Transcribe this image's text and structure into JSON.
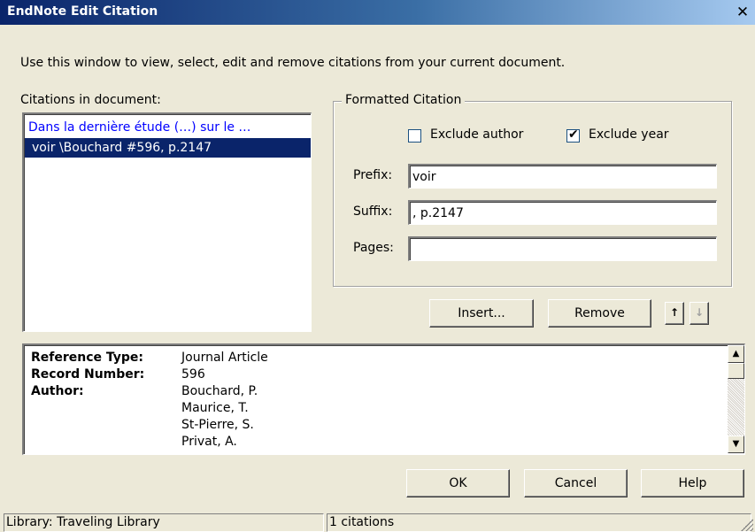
{
  "window": {
    "title": "EndNote Edit Citation",
    "close_glyph": "✕"
  },
  "instruction": "Use this window to view, select, edit and remove citations from your current document.",
  "citations": {
    "label": "Citations in document:",
    "items": [
      {
        "text": "Dans la dernière étude (…) sur le …",
        "selected": false
      },
      {
        "text": "voir \\Bouchard #596, p.2147",
        "selected": true
      }
    ]
  },
  "formatted_citation": {
    "legend": "Formatted Citation",
    "exclude_author": {
      "label": "Exclude author",
      "checked": false
    },
    "exclude_year": {
      "label": "Exclude year",
      "checked": true
    },
    "prefix": {
      "label": "Prefix:",
      "value": "voir"
    },
    "suffix": {
      "label": "Suffix:",
      "value": ", p.2147"
    },
    "pages": {
      "label": "Pages:",
      "value": ""
    }
  },
  "actions": {
    "insert": "Insert...",
    "remove": "Remove",
    "move_up": "↑",
    "move_down": "↓"
  },
  "reference": {
    "fields": [
      {
        "key": "Reference Type:",
        "value": "Journal Article"
      },
      {
        "key": "Record Number:",
        "value": "596"
      },
      {
        "key": "Author:",
        "value": "Bouchard, P."
      }
    ],
    "more_authors": [
      "Maurice, T.",
      "St-Pierre, S.",
      "Privat, A."
    ],
    "scroll_up": "▲",
    "scroll_down": "▼"
  },
  "dialog_buttons": {
    "ok": "OK",
    "cancel": "Cancel",
    "help": "Help"
  },
  "status": {
    "library": "Library: Traveling Library",
    "count": "1 citations"
  },
  "colors": {
    "selection": "#0a246a",
    "link": "#0000ff",
    "face": "#ece9d8"
  }
}
